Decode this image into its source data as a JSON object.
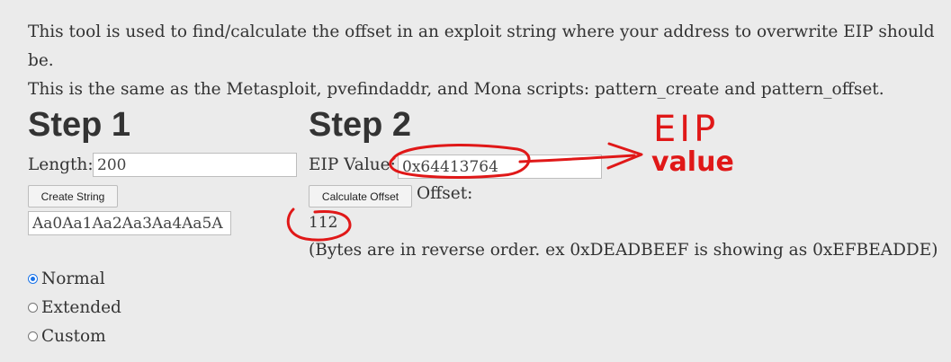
{
  "intro": {
    "line1": "This tool is used to find/calculate the offset in an exploit string where your address to overwrite EIP should be.",
    "line2": "This is the same as the Metasploit, pvefindaddr, and Mona scripts: pattern_create and pattern_offset."
  },
  "step1": {
    "heading": "Step 1",
    "length_label": "Length:",
    "length_value": "200",
    "create_button": "Create String",
    "pattern_value": "Aa0Aa1Aa2Aa3Aa4Aa5A"
  },
  "step2": {
    "heading": "Step 2",
    "eip_label": "EIP Value:",
    "eip_value": "0x64413764",
    "calc_button": "Calculate Offset",
    "offset_label": "Offset:",
    "offset_value": "112",
    "note": "(Bytes are in reverse order. ex 0xDEADBEEF is showing as 0xEFBEADDE)"
  },
  "options": [
    {
      "label": "Normal",
      "checked": true
    },
    {
      "label": "Extended",
      "checked": false
    },
    {
      "label": "Custom",
      "checked": false
    }
  ],
  "annotation": {
    "line1": "EIP",
    "line2": "value",
    "color": "#e01818"
  }
}
